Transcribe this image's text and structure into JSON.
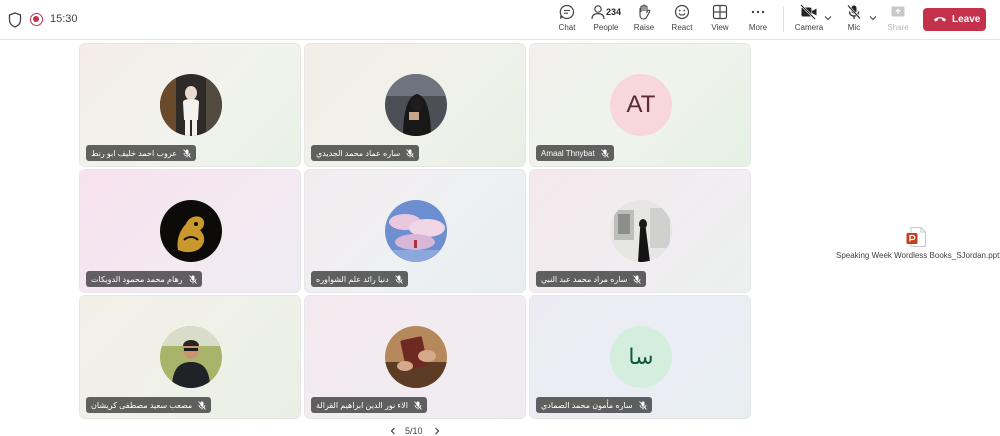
{
  "meeting": {
    "timer": "15:30",
    "record_indicator": "record-icon",
    "security_indicator": "shield-icon"
  },
  "toolbar": {
    "chat": "Chat",
    "people": "People",
    "people_count": "234",
    "raise": "Raise",
    "react": "React",
    "view": "View",
    "more": "More",
    "camera": "Camera",
    "mic": "Mic",
    "share": "Share",
    "leave": "Leave"
  },
  "participants": [
    {
      "name": "عروب احمد خليف ابو رنط",
      "avatar": "photo"
    },
    {
      "name": "ساره عماد محمد الجديدي",
      "avatar": "photo"
    },
    {
      "name": "Amaal Thnybat",
      "avatar": "initials",
      "initials": "AT"
    },
    {
      "name": "رهام محمد محمود الدويكات",
      "avatar": "photo"
    },
    {
      "name": "دنيا رائد علم الشواوره",
      "avatar": "photo"
    },
    {
      "name": "ساره مراد محمد عبد النبي",
      "avatar": "photo"
    },
    {
      "name": "مصعب سعيد مصطفى كريشان",
      "avatar": "photo"
    },
    {
      "name": "الاء نور الدين ابراهيم القرالة",
      "avatar": "photo"
    },
    {
      "name": "ساره مأمون محمد الصمادي",
      "avatar": "initials",
      "initials": "سا"
    }
  ],
  "shared_file": {
    "name": "Speaking Week Wordless Books_SJordan.pptx",
    "icon": "powerpoint-icon"
  },
  "pagination": {
    "text": "5/10"
  },
  "colors": {
    "leave": "#c4314b",
    "record": "#c4314b",
    "initials_at_bg": "#f8d7dc",
    "initials_sa_bg": "#d4eedd"
  }
}
